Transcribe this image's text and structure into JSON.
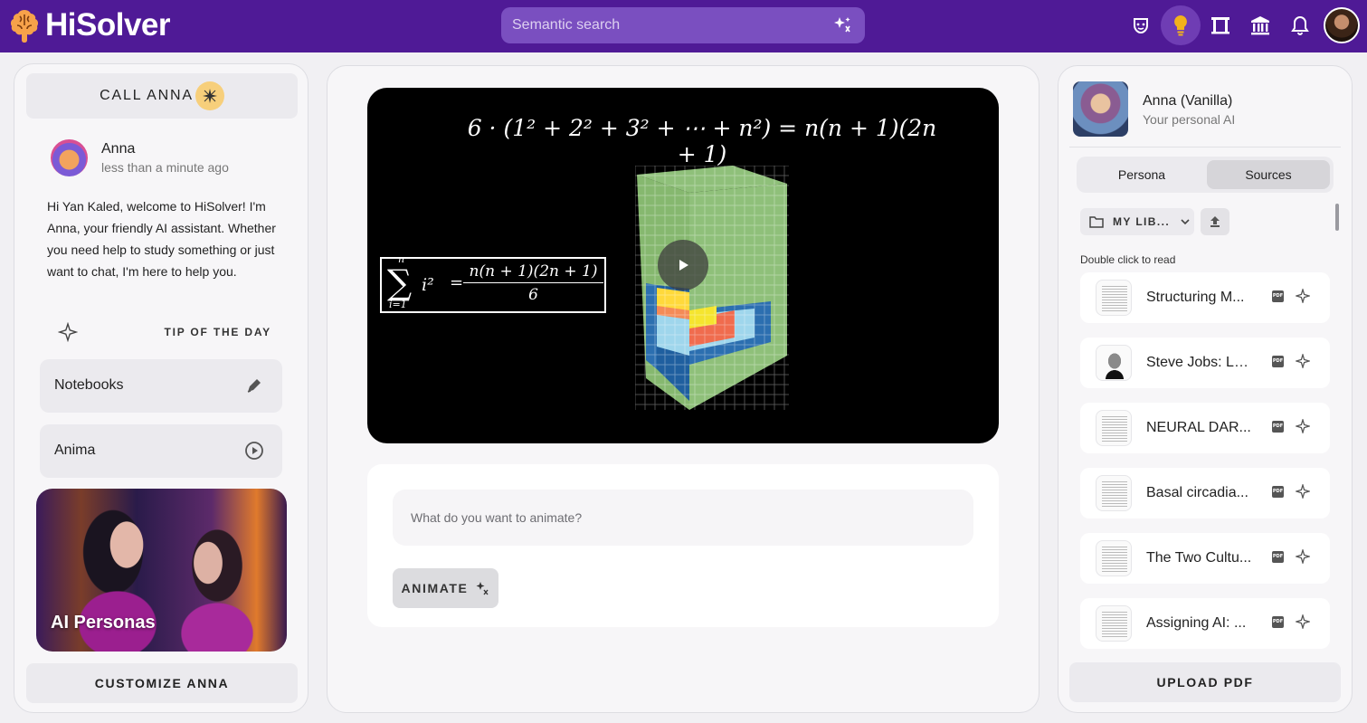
{
  "app": {
    "name": "HiSolver"
  },
  "search": {
    "placeholder": "Semantic search"
  },
  "topbar_icons": [
    "mask-icon",
    "lightbulb-icon",
    "archway-icon",
    "museum-icon",
    "bell-icon",
    "user-avatar"
  ],
  "colors": {
    "brand": "#4f1a96",
    "search_bg": "#7a4fc0",
    "bulb": "#f3b21b",
    "call_icon_bg": "#f7cf7b"
  },
  "left": {
    "call_label": "CALL ANNA",
    "assistant_name": "Anna",
    "timestamp": "less than a minute ago",
    "welcome": "Hi Yan Kaled, welcome to HiSolver! I'm Anna, your friendly AI assistant. Whether you need help to study something or just want to chat, I'm here to help you.",
    "tip_label": "TIP OF THE DAY",
    "nav": [
      {
        "label": "Notebooks",
        "icon": "pen-icon"
      },
      {
        "label": "Anima",
        "icon": "play-circle-icon"
      }
    ],
    "personas_label": "AI Personas",
    "customize_label": "CUSTOMIZE ANNA"
  },
  "center": {
    "video": {
      "equation_top": "6 · (1² + 2² + 3² + ⋯ + n²) = n(n + 1)(2n + 1)",
      "sum_upper": "n",
      "sum_lower": "i=1",
      "sum_term": "i²",
      "sum_equals": "=",
      "fraction_numerator": "n(n + 1)(2n + 1)",
      "fraction_denominator": "6"
    },
    "animate_placeholder": "What do you want to animate?",
    "animate_label": "ANIMATE"
  },
  "right": {
    "persona_name": "Anna (Vanilla)",
    "persona_sub": "Your personal AI",
    "tabs": [
      {
        "label": "Persona",
        "active": false
      },
      {
        "label": "Sources",
        "active": true
      }
    ],
    "library_label": "MY LIB...",
    "hint": "Double click to read",
    "sources": [
      {
        "title": "Structuring M...",
        "thumb": "document"
      },
      {
        "title": "Steve Jobs: La...",
        "thumb": "portrait"
      },
      {
        "title": "NEURAL DAR...",
        "thumb": "document"
      },
      {
        "title": "Basal circadia...",
        "thumb": "document"
      },
      {
        "title": "The Two Cultu...",
        "thumb": "document"
      },
      {
        "title": "Assigning AI: ...",
        "thumb": "document"
      }
    ],
    "pdf_badge": "PDF",
    "upload_label": "UPLOAD PDF"
  }
}
